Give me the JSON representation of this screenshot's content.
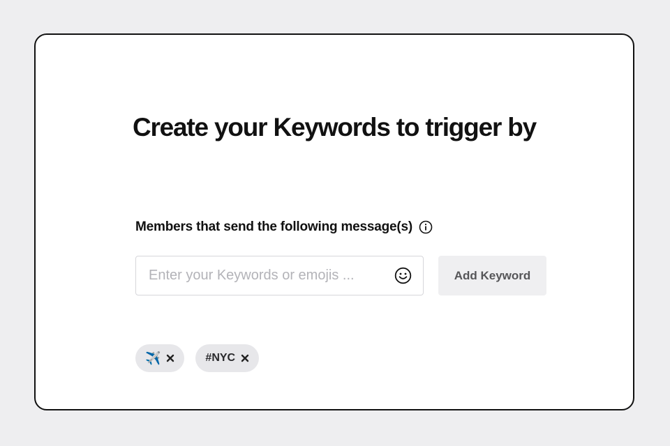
{
  "page": {
    "title": "Create your Keywords to trigger by"
  },
  "keywords_section": {
    "label": "Members that send the following message(s)",
    "info_icon": "info-icon",
    "input": {
      "placeholder": "Enter your Keywords or emojis ...",
      "value": "",
      "emoji_icon": "smiley-icon"
    },
    "add_button_label": "Add Keyword",
    "chips": [
      {
        "label": "✈️",
        "close_icon": "close-icon"
      },
      {
        "label": "#NYC",
        "close_icon": "close-icon"
      }
    ]
  },
  "colors": {
    "background": "#eeeef0",
    "card": "#ffffff",
    "card_border": "#111111",
    "chip_background": "#e7e7ea",
    "button_background": "#efeff1"
  }
}
